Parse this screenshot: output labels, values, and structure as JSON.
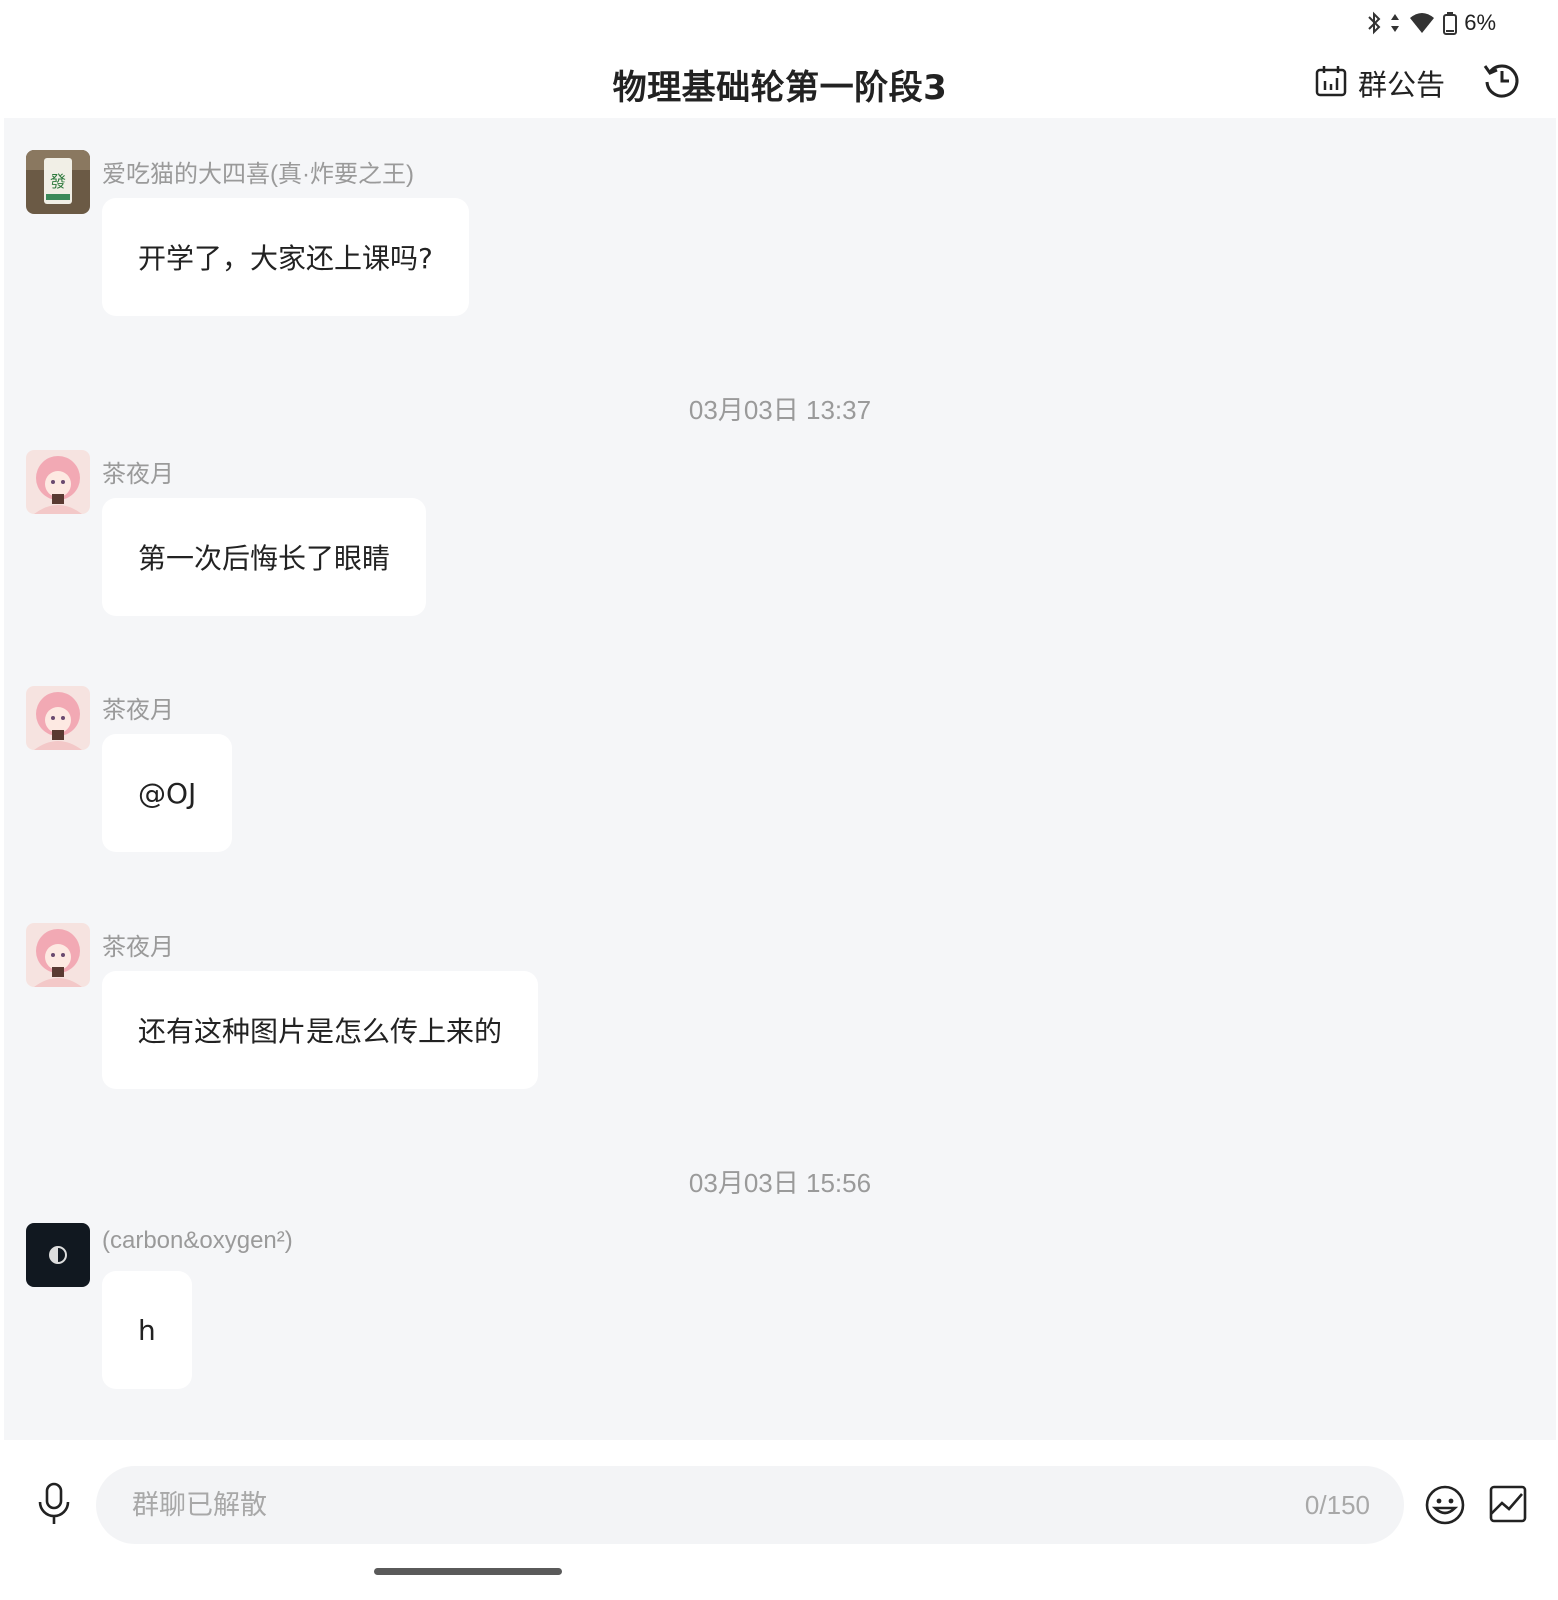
{
  "status_bar": {
    "battery_text": "6%",
    "icons": [
      "bluetooth-icon",
      "data-arrows-icon",
      "wifi-icon",
      "battery-icon"
    ]
  },
  "header": {
    "title": "物理基础轮第一阶段3",
    "notice_label": "群公告",
    "icons": [
      "calendar-icon",
      "history-icon"
    ]
  },
  "messages": [
    {
      "sender": "爱吃猫的大四喜(真·炸要之王)",
      "text": "开学了，大家还上课吗?",
      "avatar": "mahjong-tile-avatar"
    },
    {
      "timestamp": "03月03日 13:37"
    },
    {
      "sender": "茶夜月",
      "text": "第一次后悔长了眼睛",
      "avatar": "anime-girl-avatar"
    },
    {
      "sender": "茶夜月",
      "text": "@OJ",
      "avatar": "anime-girl-avatar"
    },
    {
      "sender": "茶夜月",
      "text": "还有这种图片是怎么传上来的",
      "avatar": "anime-girl-avatar"
    },
    {
      "timestamp": "03月03日 15:56"
    },
    {
      "sender": "(carbon&oxygen²)",
      "text": "h",
      "avatar": "dark-avatar"
    }
  ],
  "input": {
    "placeholder": "群聊已解散",
    "counter": "0/150",
    "icons": [
      "microphone-icon",
      "emoji-icon",
      "image-icon"
    ]
  },
  "colors": {
    "chat_background": "#f5f6f8",
    "bubble": "#ffffff",
    "secondary_text": "#9a9a9a",
    "input_background": "#f3f4f6"
  }
}
